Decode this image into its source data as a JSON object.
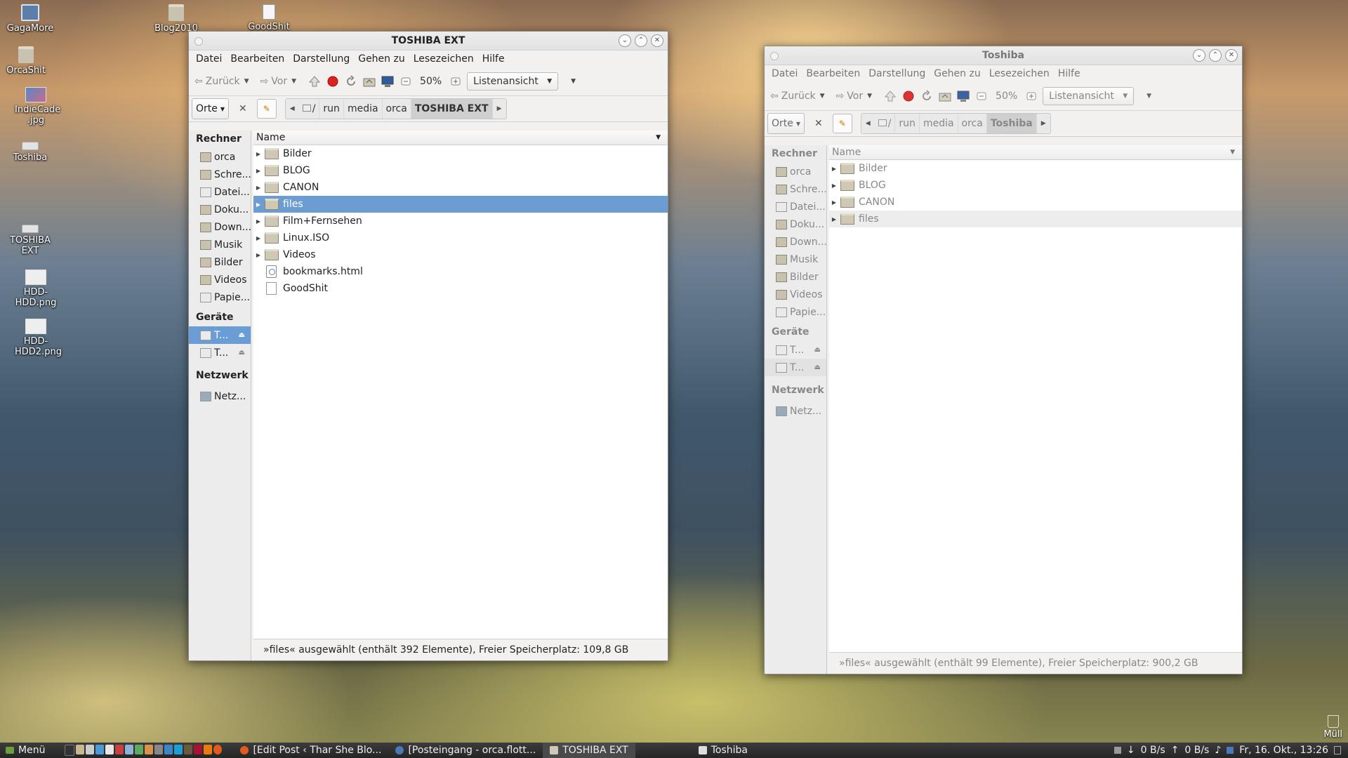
{
  "desktop": {
    "icons": [
      "GagaMore",
      "OrcaShit",
      "IndieCade .jpg",
      "Toshiba",
      "TOSHIBA EXT",
      "HDD- HDD.png",
      "HDD- HDD2.png",
      "Blog2010",
      "GoodShit"
    ],
    "trash_label": "Müll"
  },
  "window1": {
    "title": "TOSHIBA EXT",
    "menu": [
      "Datei",
      "Bearbeiten",
      "Darstellung",
      "Gehen zu",
      "Lesezeichen",
      "Hilfe"
    ],
    "toolbar": {
      "back": "Zurück",
      "forward": "Vor",
      "zoom": "50%",
      "view": "Listenansicht"
    },
    "places_label": "Orte",
    "breadcrumb": [
      "/",
      "run",
      "media",
      "orca",
      "TOSHIBA EXT"
    ],
    "sidebar": {
      "computer_heading": "Rechner",
      "computer_items": [
        "orca",
        "Schre...",
        "Datei...",
        "Doku...",
        "Down...",
        "Musik",
        "Bilder",
        "Videos",
        "Papie..."
      ],
      "devices_heading": "Geräte",
      "device_items": [
        "T...",
        "T..."
      ],
      "network_heading": "Netzwerk",
      "network_items": [
        "Netz..."
      ]
    },
    "column_name": "Name",
    "files": [
      "Bilder",
      "BLOG",
      "CANON",
      "files",
      "Film+Fernsehen",
      "Linux.ISO",
      "Videos",
      "bookmarks.html",
      "GoodShit"
    ],
    "status": "»files« ausgewählt (enthält 392 Elemente), Freier Speicherplatz: 109,8 GB"
  },
  "window2": {
    "title": "Toshiba",
    "menu": [
      "Datei",
      "Bearbeiten",
      "Darstellung",
      "Gehen zu",
      "Lesezeichen",
      "Hilfe"
    ],
    "toolbar": {
      "back": "Zurück",
      "forward": "Vor",
      "zoom": "50%",
      "view": "Listenansicht"
    },
    "places_label": "Orte",
    "breadcrumb": [
      "/",
      "run",
      "media",
      "orca",
      "Toshiba"
    ],
    "sidebar": {
      "computer_heading": "Rechner",
      "computer_items": [
        "orca",
        "Schre...",
        "Datei...",
        "Doku...",
        "Down...",
        "Musik",
        "Bilder",
        "Videos",
        "Papie..."
      ],
      "devices_heading": "Geräte",
      "device_items": [
        "T...",
        "T..."
      ],
      "network_heading": "Netzwerk",
      "network_items": [
        "Netz..."
      ]
    },
    "column_name": "Name",
    "files": [
      "Bilder",
      "BLOG",
      "CANON",
      "files"
    ],
    "status": "»files« ausgewählt (enthält 99 Elemente), Freier Speicherplatz: 900,2 GB"
  },
  "taskbar": {
    "menu_label": "Menü",
    "tasks": [
      "[Edit Post ‹ Thar She Blo...",
      "[Posteingang - orca.flott...",
      "TOSHIBA EXT",
      "Toshiba"
    ],
    "net_down": "0 B/s",
    "net_up": "0 B/s",
    "clock": "Fr, 16. Okt., 13:26"
  }
}
